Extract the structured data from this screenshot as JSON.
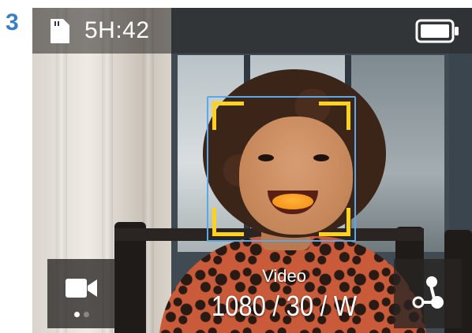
{
  "step_number": "3",
  "status_bar": {
    "sd_card_icon": "sd-card-icon",
    "recording_time_remaining": "5H:42",
    "battery_icon": "battery-icon"
  },
  "face_detection": {
    "frame_color": "#5aa8e6",
    "corner_color": "#ffd21e"
  },
  "mode_button": {
    "icon": "video-camera-icon",
    "dots": [
      {
        "active": true,
        "color": "#ffffff"
      },
      {
        "active": false,
        "color": "#8a8683"
      }
    ]
  },
  "capture_mode": {
    "label": "Video",
    "settings": "1080 / 30 / W"
  },
  "presets_button": {
    "icon": "presets-icon"
  },
  "colors": {
    "step_number": "#3a7fc1",
    "overlay": "#282422"
  }
}
